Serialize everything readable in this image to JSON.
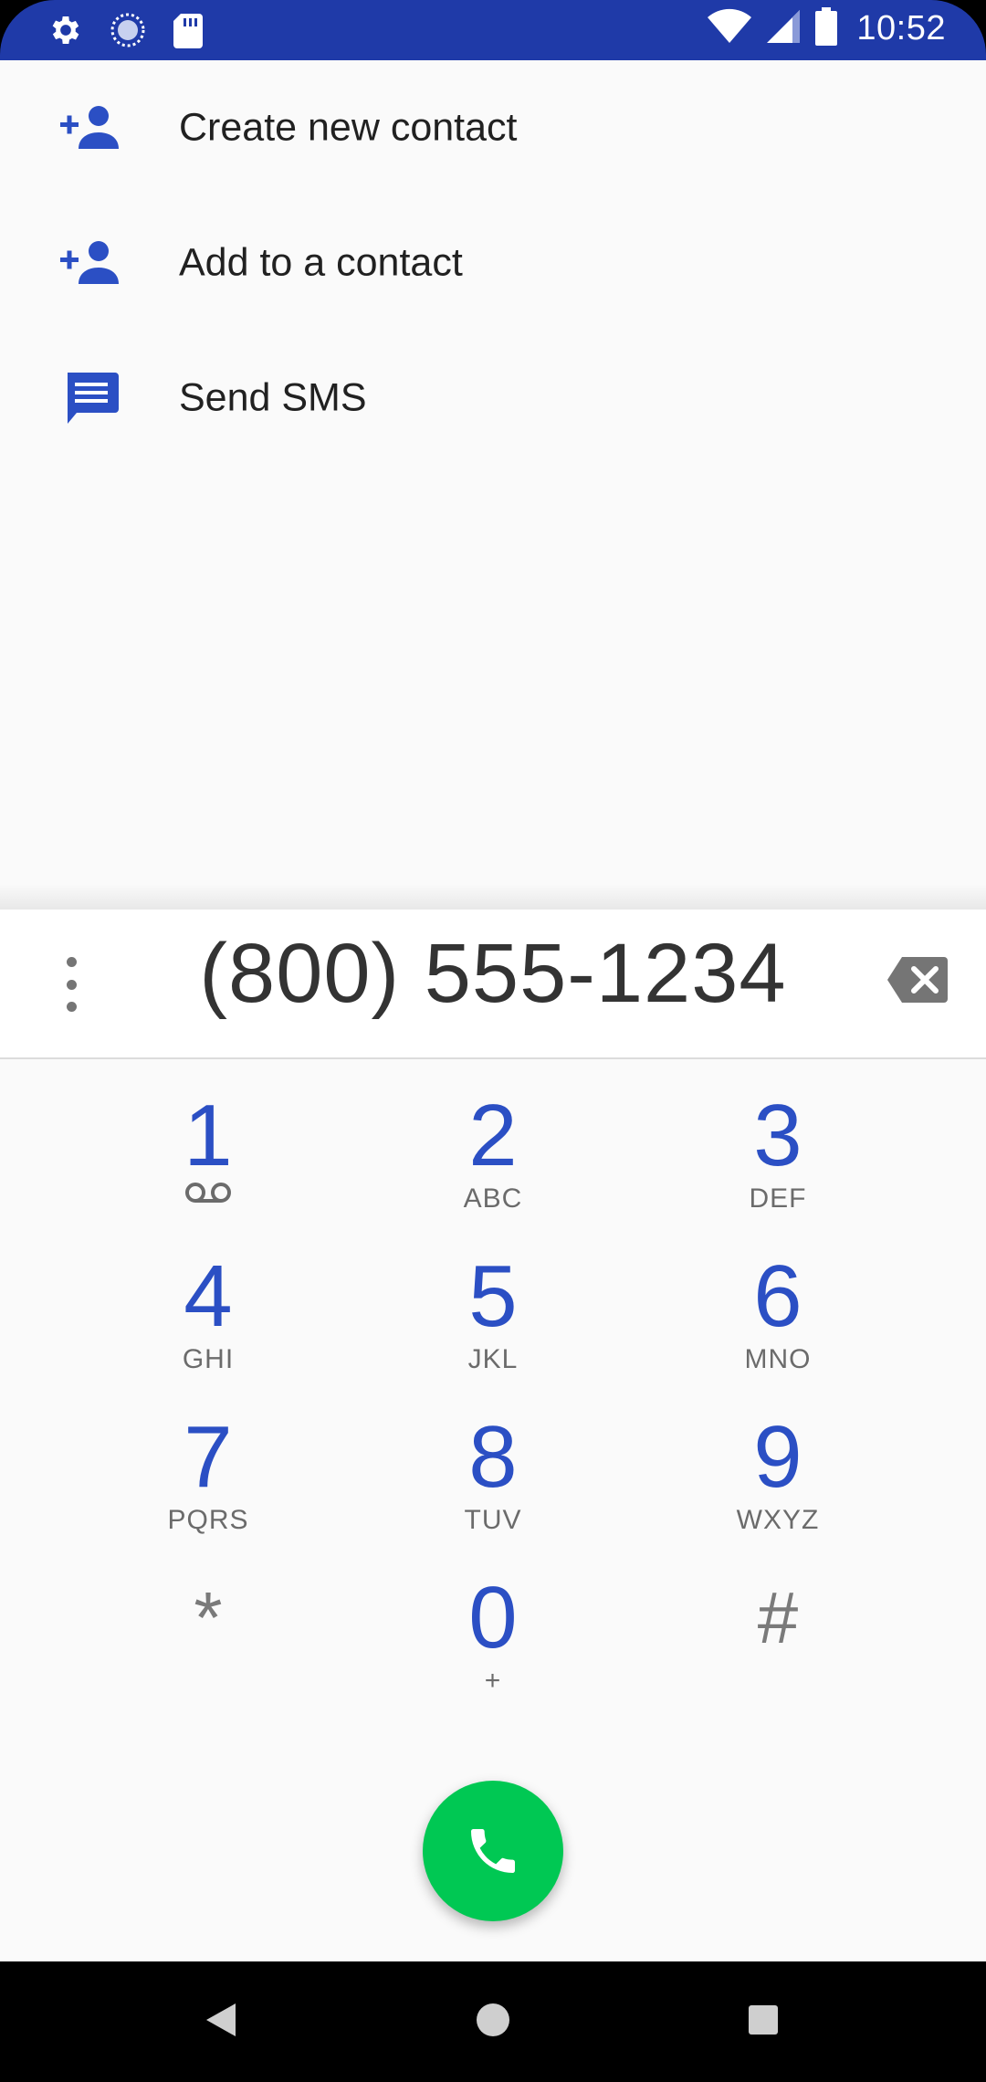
{
  "status_bar": {
    "time": "10:52",
    "left_icons": [
      "settings-icon",
      "sync-icon",
      "sd-card-icon"
    ],
    "right_icons": [
      "wifi-icon",
      "signal-icon",
      "battery-icon"
    ],
    "color": "#1f3aa8"
  },
  "actions": [
    {
      "label": "Create new contact",
      "icon": "person-add-icon"
    },
    {
      "label": "Add to a contact",
      "icon": "person-add-icon"
    },
    {
      "label": "Send SMS",
      "icon": "message-icon"
    }
  ],
  "dialpad": {
    "number": "(800) 555-1234",
    "keys": [
      {
        "digit": "1",
        "letters": "",
        "sub_icon": "voicemail-icon"
      },
      {
        "digit": "2",
        "letters": "ABC"
      },
      {
        "digit": "3",
        "letters": "DEF"
      },
      {
        "digit": "4",
        "letters": "GHI"
      },
      {
        "digit": "5",
        "letters": "JKL"
      },
      {
        "digit": "6",
        "letters": "MNO"
      },
      {
        "digit": "7",
        "letters": "PQRS"
      },
      {
        "digit": "8",
        "letters": "TUV"
      },
      {
        "digit": "9",
        "letters": "WXYZ"
      },
      {
        "digit": "*",
        "letters": ""
      },
      {
        "digit": "0",
        "letters": "+"
      },
      {
        "digit": "#",
        "letters": ""
      }
    ],
    "accent_color": "#2b4fc4",
    "call_button_color": "#00c853"
  },
  "nav_bar": {
    "buttons": [
      "back-icon",
      "home-icon",
      "recents-icon"
    ]
  }
}
